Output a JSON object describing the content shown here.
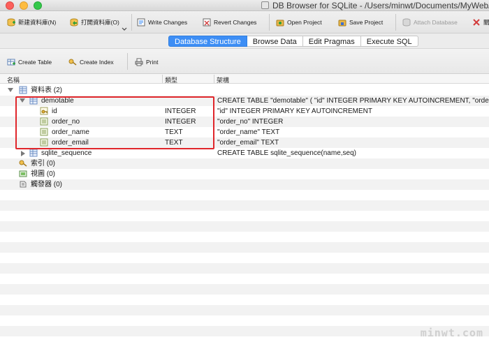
{
  "window": {
    "title": "DB Browser for SQLite - /Users/minwt/Documents/MyWeb/wwwroot/"
  },
  "toolbar": {
    "new_db": "新建資料庫(N)",
    "open_db": "打開資料庫(O)",
    "write_changes": "Write Changes",
    "revert_changes": "Revert Changes",
    "open_project": "Open Project",
    "save_project": "Save Project",
    "attach_database": "Attach Database",
    "close_db": "關"
  },
  "tabs": [
    {
      "label": "Database Structure",
      "active": true
    },
    {
      "label": "Browse Data",
      "active": false
    },
    {
      "label": "Edit Pragmas",
      "active": false
    },
    {
      "label": "Execute SQL",
      "active": false
    }
  ],
  "structure_toolbar": {
    "create_table": "Create Table",
    "create_index": "Create Index",
    "print": "Print"
  },
  "tree": {
    "headers": {
      "name": "名稱",
      "type": "類型",
      "schema": "架構"
    },
    "rows": [
      {
        "name": "資料表 (2)",
        "type": "",
        "schema": "",
        "icon": "table-group-icon",
        "expander": "down"
      },
      {
        "name": "demotable",
        "type": "",
        "schema": "CREATE TABLE \"demotable\" ( \"id\" INTEGER PRIMARY KEY AUTOINCREMENT, \"order_",
        "icon": "table-icon",
        "expander": "down"
      },
      {
        "name": "id",
        "type": "INTEGER",
        "schema": "\"id\" INTEGER PRIMARY KEY AUTOINCREMENT",
        "icon": "primary-key-field-icon",
        "expander": ""
      },
      {
        "name": "order_no",
        "type": "INTEGER",
        "schema": "\"order_no\" INTEGER",
        "icon": "field-icon",
        "expander": ""
      },
      {
        "name": "order_name",
        "type": "TEXT",
        "schema": "\"order_name\" TEXT",
        "icon": "field-icon",
        "expander": ""
      },
      {
        "name": "order_email",
        "type": "TEXT",
        "schema": "\"order_email\" TEXT",
        "icon": "field-icon",
        "expander": ""
      },
      {
        "name": "sqlite_sequence",
        "type": "",
        "schema": "CREATE TABLE sqlite_sequence(name,seq)",
        "icon": "table-icon",
        "expander": "right"
      },
      {
        "name": "索引 (0)",
        "type": "",
        "schema": "",
        "icon": "index-icon",
        "expander": ""
      },
      {
        "name": "視圖 (0)",
        "type": "",
        "schema": "",
        "icon": "view-icon",
        "expander": ""
      },
      {
        "name": "觸發器 (0)",
        "type": "",
        "schema": "",
        "icon": "trigger-icon",
        "expander": ""
      }
    ]
  },
  "watermark": "minwt.com",
  "colors": {
    "accent": "#3d8ef5",
    "highlight_box": "#e0262b"
  }
}
